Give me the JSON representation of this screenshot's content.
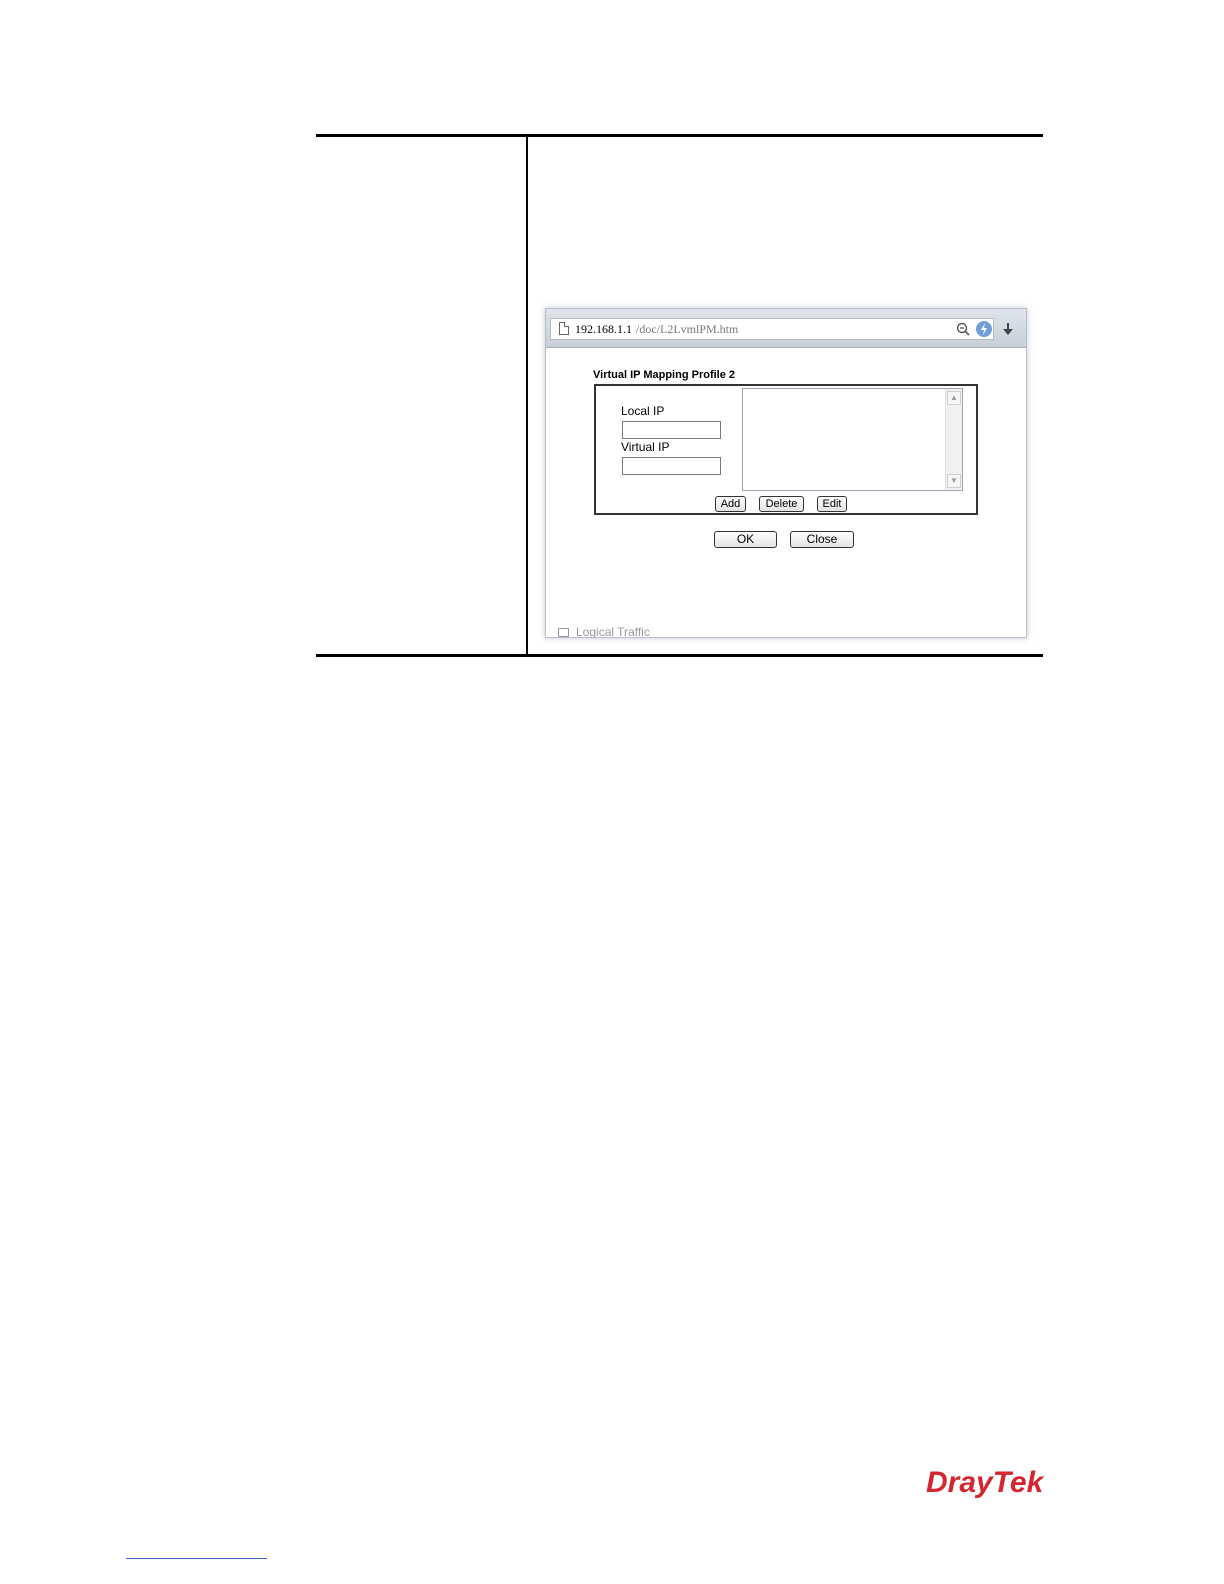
{
  "browser": {
    "url_host": "192.168.1.1",
    "url_path": "/doc/L2LvmlPM.htm"
  },
  "dialog": {
    "title": "Virtual IP Mapping Profile 2",
    "local_ip_label": "Local IP",
    "local_ip_value": "",
    "virtual_ip_label": "Virtual IP",
    "virtual_ip_value": "",
    "list_items": [],
    "buttons": {
      "add": "Add",
      "delete": "Delete",
      "edit": "Edit",
      "ok": "OK",
      "close": "Close"
    }
  },
  "background_fragment": "Logical Traffic",
  "logo": "DrayTek",
  "icons": {
    "page": "page-icon",
    "zoom": "zoom-icon",
    "bolt": "bolt-icon",
    "download": "download-icon"
  },
  "colors": {
    "logo": "#d3262f",
    "footer_link_line": "#3b5fbf"
  }
}
